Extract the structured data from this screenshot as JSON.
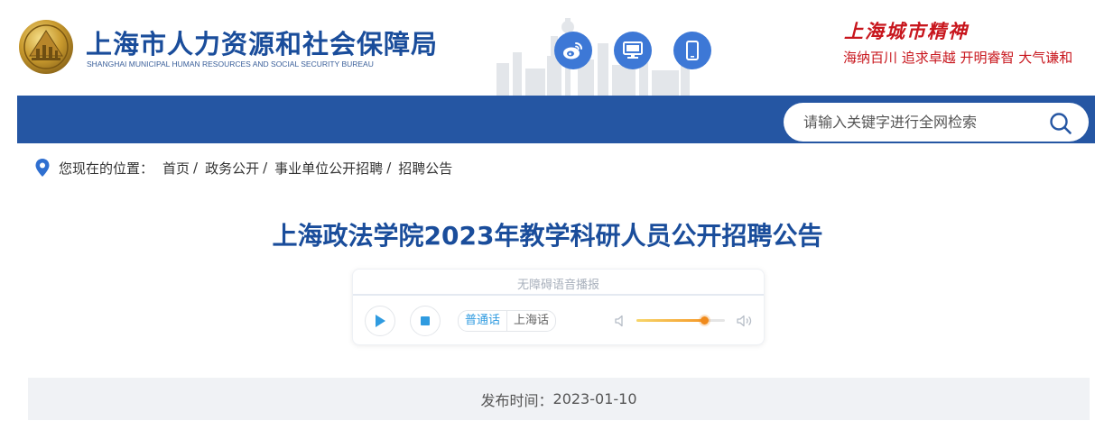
{
  "header": {
    "site_name_cn": "上海市人力资源和社会保障局",
    "site_name_en": "SHANGHAI MUNICIPAL HUMAN RESOURCES AND SOCIAL SECURITY BUREAU",
    "social_icons": [
      "weibo-icon",
      "desktop-icon",
      "mobile-icon"
    ],
    "motto_title": "上海城市精神",
    "motto_sub": "海纳百川  追求卓越  开明睿智  大气谦和"
  },
  "search": {
    "placeholder": "请输入关键字进行全网检索"
  },
  "breadcrumb": {
    "prefix": "您现在的位置：",
    "items": [
      "首页",
      "政务公开",
      "事业单位公开招聘",
      "招聘公告"
    ]
  },
  "article": {
    "title": "上海政法学院2023年教学科研人员公开招聘公告",
    "publish_label": "发布时间：",
    "publish_date": "2023-01-10"
  },
  "player": {
    "title": "无障碍语音播报",
    "languages": [
      "普通话",
      "上海话"
    ],
    "active_language": "普通话",
    "progress": 0.0,
    "volume": 0.77
  },
  "colors": {
    "brand_blue": "#2556a3",
    "title_blue": "#1a4d9b",
    "motto_red": "#c8161d",
    "icon_blue": "#3d78d6",
    "volume_orange": "#f08a1b"
  }
}
